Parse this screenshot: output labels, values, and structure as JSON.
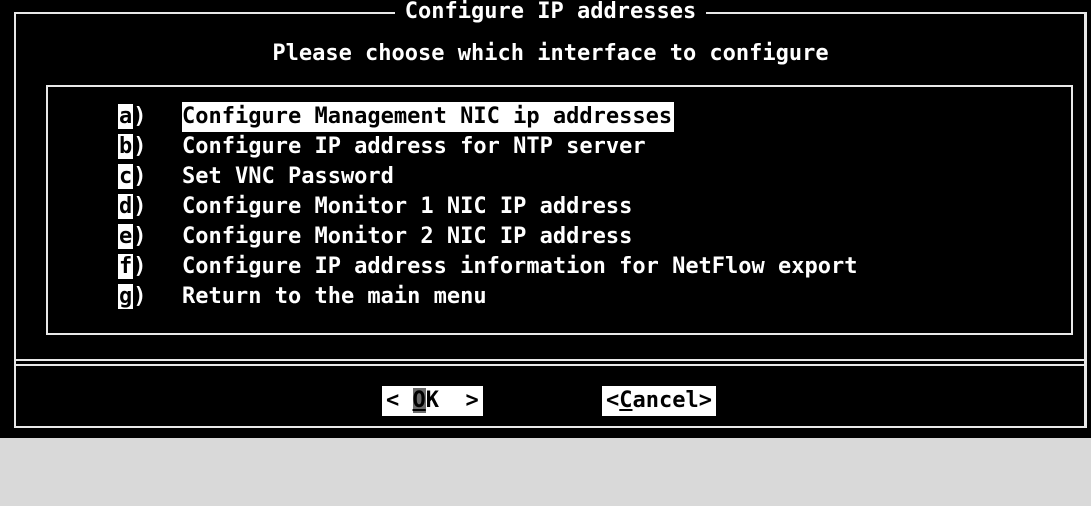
{
  "dialog": {
    "title": "Configure IP addresses",
    "subtitle": "Please choose which interface to configure"
  },
  "menu": {
    "items": [
      {
        "key": "a",
        "suffix": ")",
        "label": "Configure Management NIC ip addresses",
        "selected": true
      },
      {
        "key": "b",
        "suffix": ")",
        "label": "Configure IP address for NTP server"
      },
      {
        "key": "c",
        "suffix": ")",
        "label": "Set VNC Password"
      },
      {
        "key": "d",
        "suffix": ")",
        "label": "Configure Monitor 1 NIC IP address"
      },
      {
        "key": "e",
        "suffix": ")",
        "label": "Configure Monitor 2 NIC IP address"
      },
      {
        "key": "f",
        "suffix": ")",
        "label": "Configure IP address information for NetFlow export"
      },
      {
        "key": "g",
        "suffix": ")",
        "label": "Return to the main menu"
      }
    ]
  },
  "buttons": {
    "ok": {
      "left": "< ",
      "hot": "O",
      "rest": "K  >"
    },
    "cancel": {
      "left": "<",
      "hot": "C",
      "rest": "ancel>"
    }
  }
}
